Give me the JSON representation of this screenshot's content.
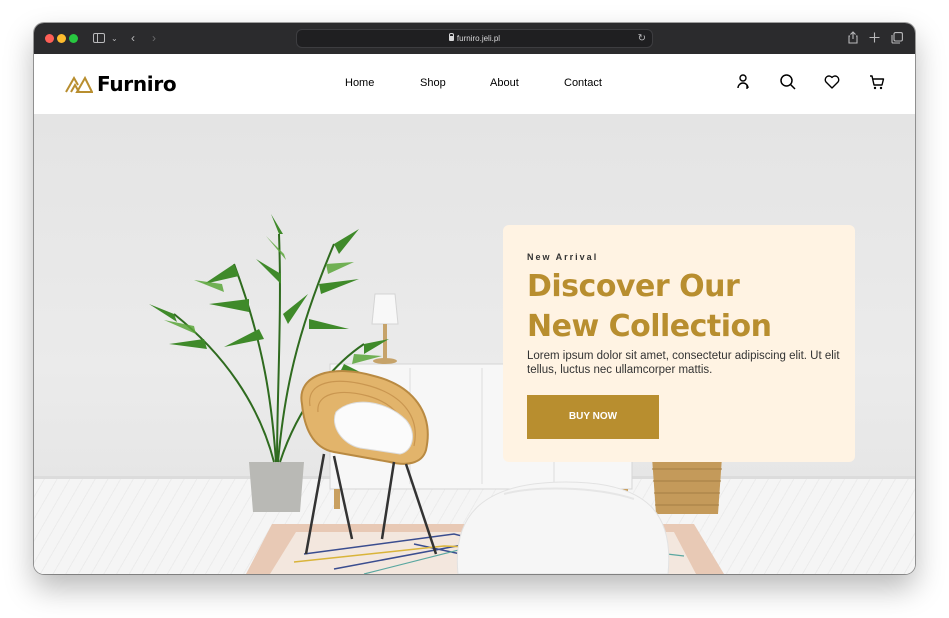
{
  "browser": {
    "url": "furniro.jeli.pl",
    "back_icon": "chevron-left-icon",
    "forward_icon": "chevron-right-icon"
  },
  "site": {
    "logo_text": "Furniro",
    "nav": [
      {
        "label": "Home"
      },
      {
        "label": "Shop"
      },
      {
        "label": "About"
      },
      {
        "label": "Contact"
      }
    ],
    "icons": [
      "account-icon",
      "search-icon",
      "heart-icon",
      "cart-icon"
    ]
  },
  "hero": {
    "eyebrow": "New Arrival",
    "title_line1": "Discover Our",
    "title_line2": "New Collection",
    "description": "Lorem ipsum dolor sit amet, consectetur adipiscing elit. Ut elit tellus, luctus nec ullamcorper mattis.",
    "cta_label": "BUY NOW"
  },
  "colors": {
    "accent": "#b88e2f",
    "card_bg": "#fff3e3",
    "toolbar_bg": "#2b2b2d"
  }
}
